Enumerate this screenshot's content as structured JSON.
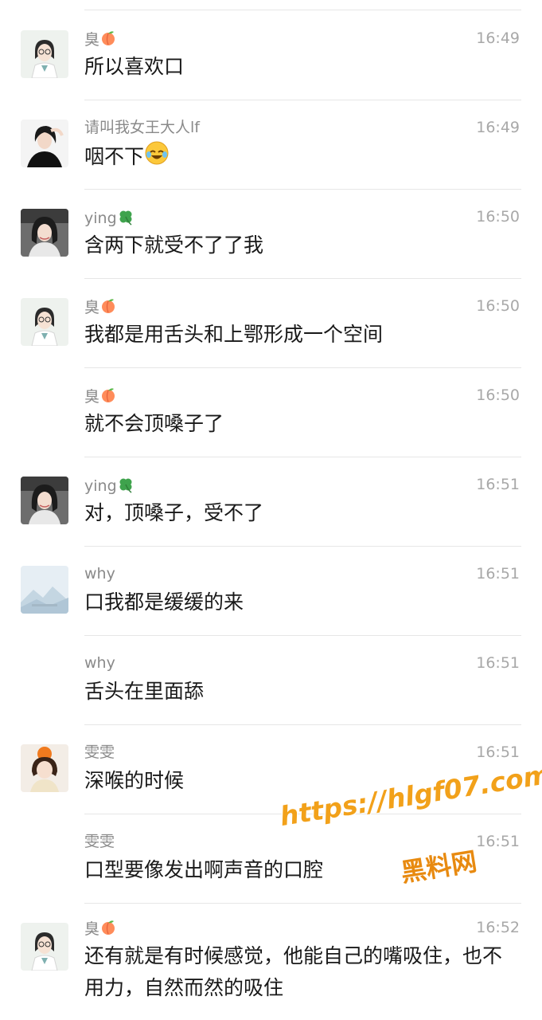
{
  "messages": [
    {
      "name": "臭",
      "name_emoji": "peach",
      "avatar": "doctor",
      "time": "16:49",
      "text": "所以喜欢口"
    },
    {
      "name": "请叫我女王大人lf",
      "name_emoji": "",
      "avatar": "woman-dark",
      "time": "16:49",
      "text": "咽不下",
      "text_emoji": "rofl"
    },
    {
      "name": "ying",
      "name_emoji": "clover",
      "avatar": "woman-car",
      "time": "16:50",
      "text": "含两下就受不了了我"
    },
    {
      "name": "臭",
      "name_emoji": "peach",
      "avatar": "doctor",
      "time": "16:50",
      "text": "我都是用舌头和上鄂形成一个空间"
    },
    {
      "name": "臭",
      "name_emoji": "peach",
      "avatar": "",
      "time": "16:50",
      "text": "就不会顶嗓子了"
    },
    {
      "name": "ying",
      "name_emoji": "clover",
      "avatar": "woman-car",
      "time": "16:51",
      "text": "对，顶嗓子，受不了"
    },
    {
      "name": "why",
      "name_emoji": "",
      "avatar": "landscape",
      "time": "16:51",
      "text": "口我都是缓缓的来"
    },
    {
      "name": "why",
      "name_emoji": "",
      "avatar": "",
      "time": "16:51",
      "text": "舌头在里面舔"
    },
    {
      "name": "雯雯",
      "name_emoji": "",
      "avatar": "girl-orange",
      "time": "16:51",
      "text": "深喉的时候"
    },
    {
      "name": "雯雯",
      "name_emoji": "",
      "avatar": "",
      "time": "16:51",
      "text": "口型要像发出啊声音的口腔"
    },
    {
      "name": "臭",
      "name_emoji": "peach",
      "avatar": "doctor",
      "time": "16:52",
      "text": "还有就是有时候感觉，他能自己的嘴吸住，也不用力，自然而然的吸住"
    }
  ],
  "watermark": {
    "url": "https://hlgf07.com",
    "label": "黑料网"
  }
}
